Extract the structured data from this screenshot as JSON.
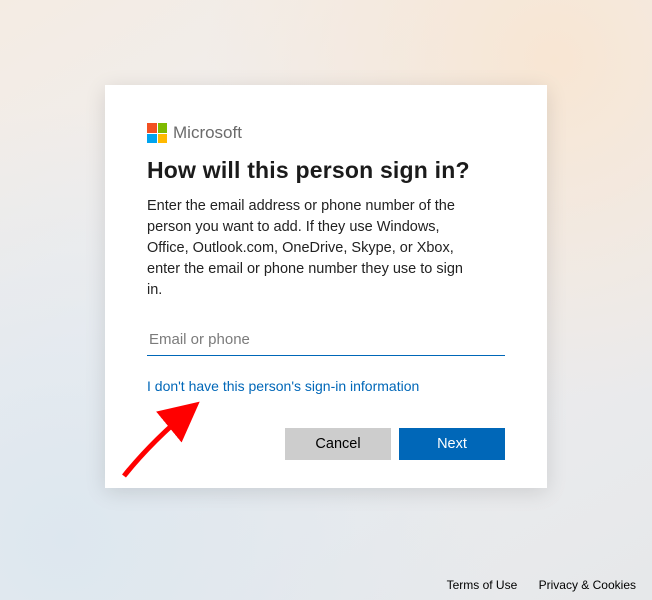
{
  "brand_name": "Microsoft",
  "heading": "How will this person sign in?",
  "description": "Enter the email address or phone number of the person you want to add. If they use Windows, Office, Outlook.com, OneDrive, Skype, or Xbox, enter the email or phone number they use to sign in.",
  "input": {
    "value": "",
    "placeholder": "Email or phone"
  },
  "alt_link_label": "I don't have this person's sign-in information",
  "buttons": {
    "cancel": "Cancel",
    "next": "Next"
  },
  "footer": {
    "terms": "Terms of Use",
    "privacy": "Privacy & Cookies"
  },
  "colors": {
    "accent": "#0067B8"
  }
}
